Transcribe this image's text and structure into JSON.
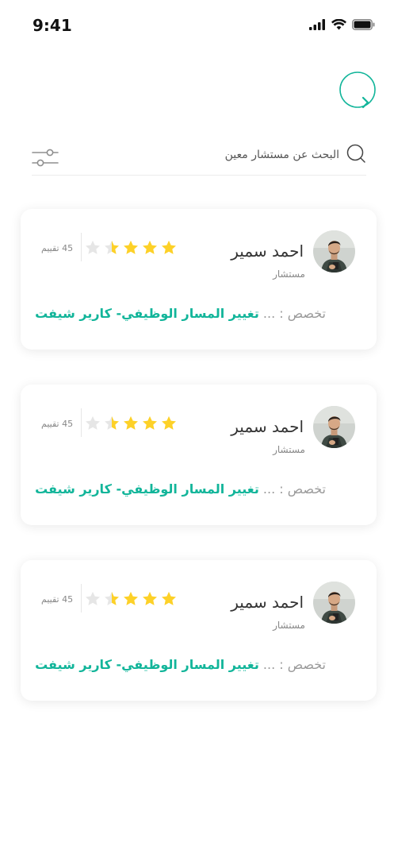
{
  "status_bar": {
    "time": "9:41"
  },
  "search": {
    "placeholder": "البحث عن مستشار معين"
  },
  "consultants": [
    {
      "name": "احمد سمير",
      "role": "مستشار",
      "rating": 3.5,
      "max_rating": 5,
      "rating_count": "45 تقييم",
      "specialty_label": "تخصص : ...",
      "specialty_value": "تغيير المسار الوظيفي- كارير شيفت"
    },
    {
      "name": "احمد سمير",
      "role": "مستشار",
      "rating": 3.5,
      "max_rating": 5,
      "rating_count": "45 تقييم",
      "specialty_label": "تخصص : ...",
      "specialty_value": "تغيير المسار الوظيفي- كارير شيفت"
    },
    {
      "name": "احمد سمير",
      "role": "مستشار",
      "rating": 3.5,
      "max_rating": 5,
      "rating_count": "45 تقييم",
      "specialty_label": "تخصص : ...",
      "specialty_value": "تغيير المسار الوظيفي- كارير شيفت"
    }
  ],
  "colors": {
    "accent": "#12b59a",
    "star": "#fdd128",
    "star_empty": "#e6e6e6"
  },
  "icons": {
    "back": "chevron-right-circle-icon",
    "filter": "sliders-icon",
    "search": "search-icon"
  }
}
